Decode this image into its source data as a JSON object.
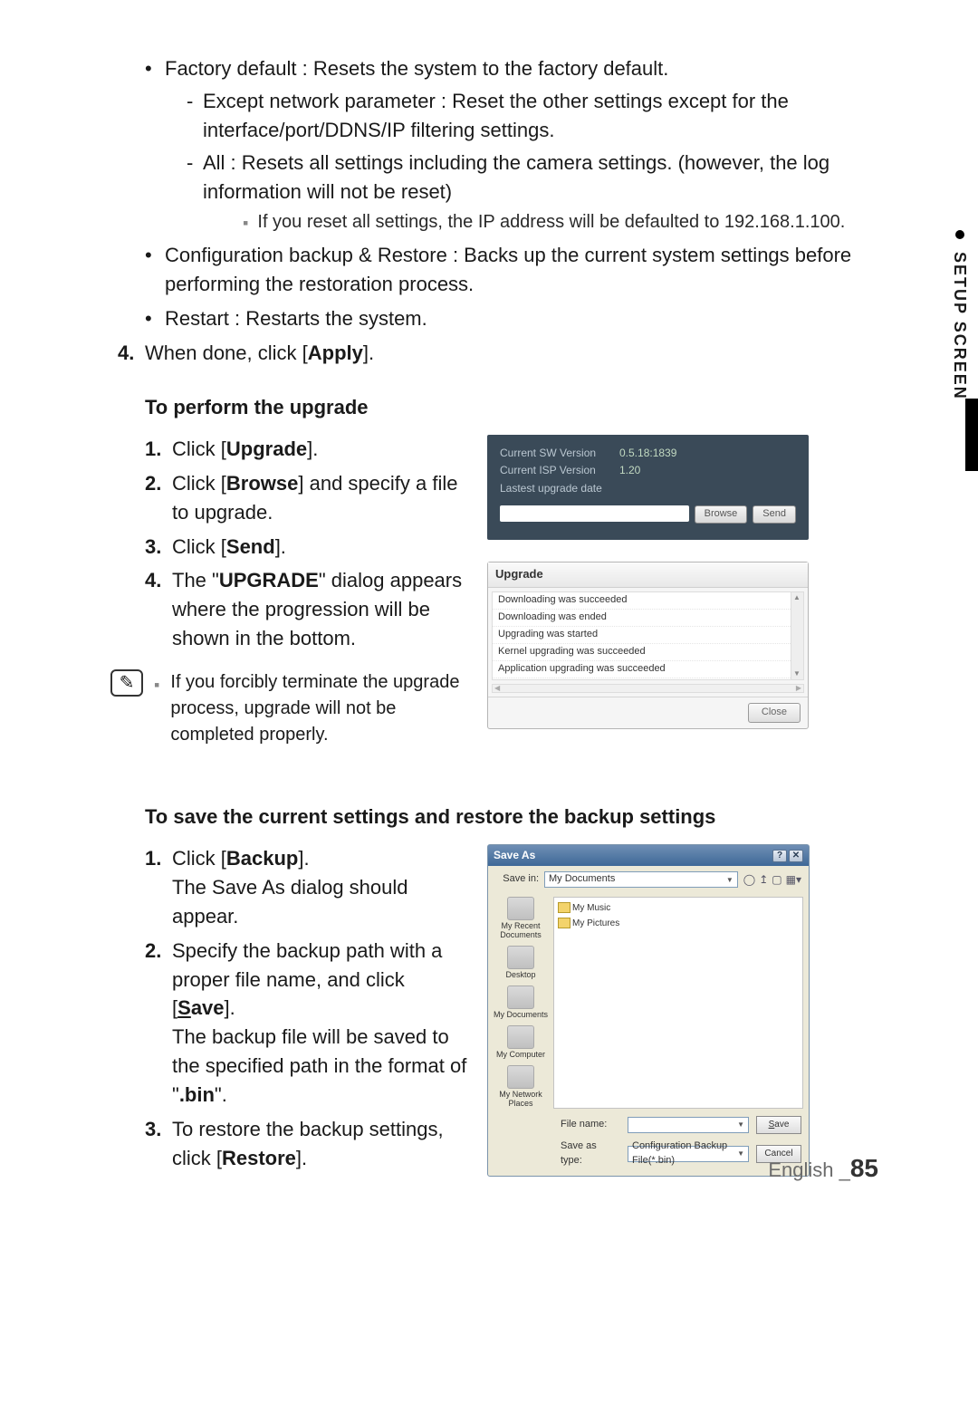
{
  "side_tab": "SETUP SCREEN",
  "bullets": {
    "factory_default": "Factory default : Resets the system to the factory default.",
    "fd_dash1": "Except network parameter : Reset the other settings except for the interface/port/DDNS/IP filtering settings.",
    "fd_dash2": "All : Resets all settings including the camera settings. (however, the log information will not be reset)",
    "fd_note": "If you reset all settings, the IP address will be defaulted to 192.168.1.100.",
    "config_backup": "Configuration backup & Restore : Backs up the current system settings before performing the restoration process.",
    "restart": "Restart : Restarts the system."
  },
  "step4_prefix": "4.",
  "step4_a": "When done, click [",
  "step4_b": "Apply",
  "step4_c": "].",
  "heading_upgrade": "To perform the upgrade",
  "upgrade_steps": {
    "n1": "1.",
    "s1a": "Click [",
    "s1b": "Upgrade",
    "s1c": "].",
    "n2": "2.",
    "s2a": "Click [",
    "s2b": "Browse",
    "s2c": "] and specify a file to upgrade.",
    "n3": "3.",
    "s3a": "Click [",
    "s3b": "Send",
    "s3c": "].",
    "n4": "4.",
    "s4a": "The \"",
    "s4b": "UPGRADE",
    "s4c": "\" dialog appears where the progression will be shown in the bottom."
  },
  "upgrade_note": "If you forcibly terminate the upgrade process, upgrade will not be completed properly.",
  "shot_upgrade": {
    "l1_lbl": "Current SW Version",
    "l1_val": "0.5.18:1839",
    "l2_lbl": "Current ISP Version",
    "l2_val": "1.20",
    "l3_lbl": "Lastest upgrade date",
    "btn_browse": "Browse",
    "btn_send": "Send",
    "panel_title": "Upgrade",
    "lines": [
      "Downloading was succeeded",
      "Downloading was ended",
      "Upgrading was started",
      "Kernel upgrading was succeeded",
      "Application upgrading was succeeded"
    ],
    "btn_close": "Close"
  },
  "heading_backup": "To save the current settings and restore the backup settings",
  "backup_steps": {
    "n1": "1.",
    "b1a": "Click [",
    "b1b": "Backup",
    "b1c": "].",
    "b1d": "The Save As dialog should appear.",
    "n2": "2.",
    "b2a": "Specify the backup path with a proper file name, and click [",
    "b2b": "S",
    "b2c": "ave",
    "b2d": "].",
    "b2e_a": "The backup file will be saved to the specified path in the format of \"",
    "b2e_b": ".bin",
    "b2e_c": "\".",
    "n3": "3.",
    "b3a": "To restore the backup settings, click [",
    "b3b": "Restore",
    "b3c": "]."
  },
  "shot_saveas": {
    "title": "Save As",
    "savein_lbl": "Save in:",
    "savein_val": "My Documents",
    "folders": [
      "My Music",
      "My Pictures"
    ],
    "places": [
      "My Recent Documents",
      "Desktop",
      "My Documents",
      "My Computer",
      "My Network Places"
    ],
    "filename_lbl": "File name:",
    "filename_val": "",
    "savetype_lbl": "Save as type:",
    "savetype_val": "Configuration Backup File(*.bin)",
    "btn_save": "Save",
    "btn_cancel": "Cancel",
    "win_help": "?",
    "win_close": "✕"
  },
  "footer_lang": "English _",
  "footer_page": "85"
}
